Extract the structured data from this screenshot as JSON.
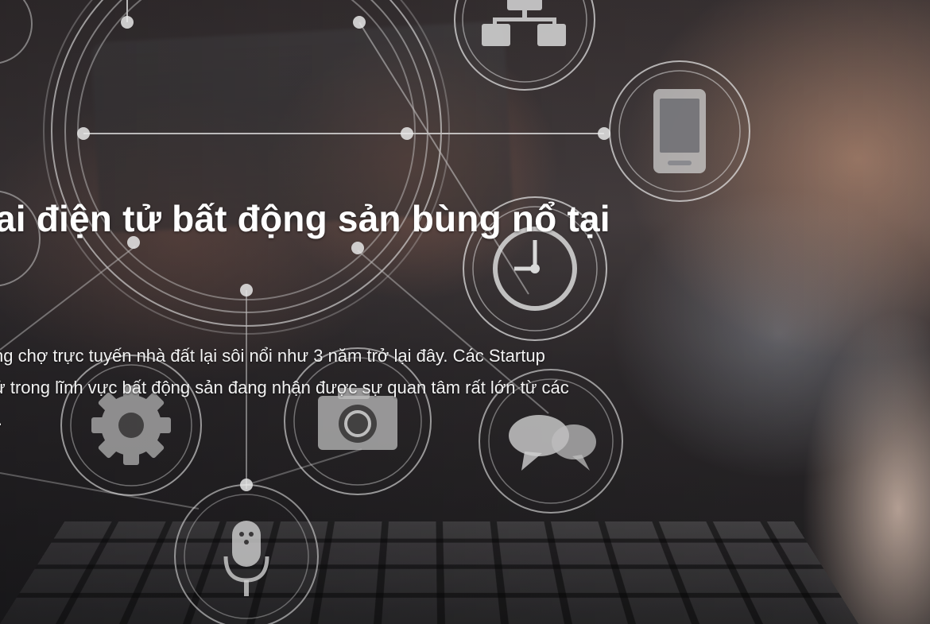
{
  "hero": {
    "title": "ai điện tử bất động sản bùng nổ tại",
    "description_lines": [
      "ng chợ trực tuyến nhà đất lại sôi nổi như 3 năm trở lại đây. Các Startup",
      "ử trong lĩnh vực bất động sản đang nhận được sự quan tâm rất lớn từ các",
      "i."
    ]
  },
  "icons": [
    "sitemap-icon",
    "mobile-phone-icon",
    "clock-icon",
    "gear-icon",
    "camera-icon",
    "chat-bubbles-icon",
    "microphone-icon"
  ],
  "colors": {
    "text": "#ffffff",
    "network_lines": "#e8e8e8"
  }
}
